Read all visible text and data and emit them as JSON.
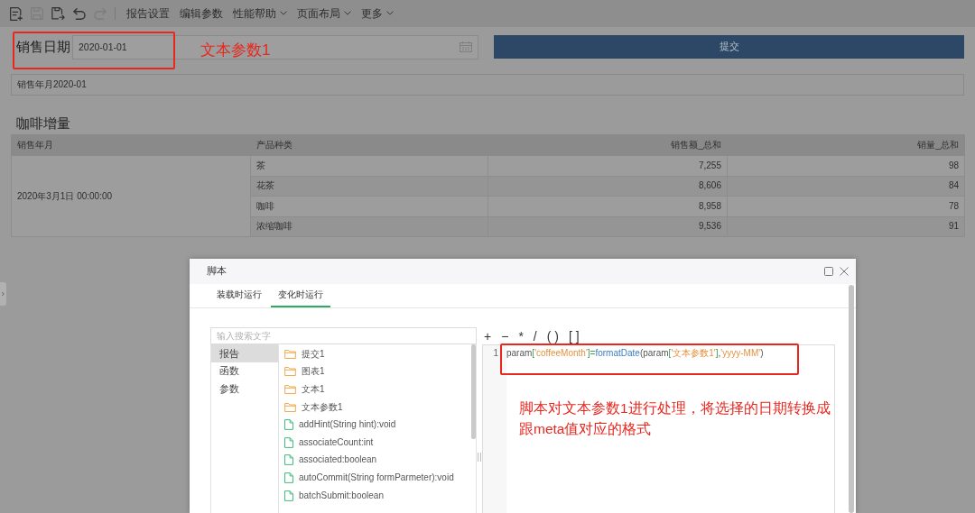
{
  "toolbar": {
    "icons": [
      {
        "kind": "new",
        "disabled": false
      },
      {
        "kind": "save",
        "disabled": true
      },
      {
        "kind": "save_as",
        "disabled": false
      },
      {
        "kind": "undo",
        "disabled": false
      },
      {
        "kind": "redo",
        "disabled": true
      }
    ],
    "menus": [
      {
        "label": "报告设置",
        "dropdown": false
      },
      {
        "label": "编辑参数",
        "dropdown": false
      },
      {
        "label": "性能帮助",
        "dropdown": true
      },
      {
        "label": "页面布局",
        "dropdown": true
      },
      {
        "label": "更多",
        "dropdown": true
      }
    ]
  },
  "filter": {
    "label": "销售日期",
    "value": "2020-01-01",
    "submit": "提交",
    "annotation": "文本参数1"
  },
  "display_text": "销售年月2020-01",
  "report": {
    "title": "咖啡增量",
    "columns": [
      {
        "label": "销售年月",
        "kind": "text"
      },
      {
        "label": "产品种类",
        "kind": "text"
      },
      {
        "label": "销售额_总和",
        "kind": "number"
      },
      {
        "label": "销量_总和",
        "kind": "number"
      }
    ],
    "groups": [
      {
        "label": "2020年3月1日 00:00:00",
        "rows": [
          [
            "茶",
            "7,255",
            "98"
          ],
          [
            "花茶",
            "8,606",
            "84"
          ],
          [
            "咖啡",
            "8,958",
            "78"
          ],
          [
            "浓缩咖啡",
            "9,536",
            "91"
          ]
        ]
      }
    ]
  },
  "dialog": {
    "title": "脚本",
    "tabs": [
      {
        "label": "装载时运行",
        "selected": false
      },
      {
        "label": "变化时运行",
        "selected": true
      }
    ],
    "search": {
      "placeholder": "输入搜索文字"
    },
    "operators": [
      "+",
      "−",
      "*",
      "/",
      "( )",
      "[ ]"
    ],
    "categories": [
      {
        "label": "报告",
        "selected": true
      },
      {
        "label": "函数",
        "selected": false
      },
      {
        "label": "参数",
        "selected": false
      }
    ],
    "members": [
      {
        "kind": "folder",
        "label": "提交1"
      },
      {
        "kind": "folder",
        "label": "图表1"
      },
      {
        "kind": "folder",
        "label": "文本1"
      },
      {
        "kind": "folder",
        "label": "文本参数1"
      },
      {
        "kind": "method",
        "label": "addHint(String hint):void"
      },
      {
        "kind": "method",
        "label": "associateCount:int"
      },
      {
        "kind": "method",
        "label": "associated:boolean"
      },
      {
        "kind": "method",
        "label": "autoCommit(String formParmeter):void"
      },
      {
        "kind": "method",
        "label": "batchSubmit:boolean"
      }
    ],
    "editor": {
      "lines": [
        {
          "number": "1",
          "tokens": [
            {
              "kind": "plain",
              "text": "param"
            },
            {
              "kind": "bracket",
              "text": "["
            },
            {
              "kind": "string",
              "text": "'coffeeMonth'"
            },
            {
              "kind": "bracket",
              "text": "]"
            },
            {
              "kind": "bracket",
              "text": "="
            },
            {
              "kind": "function",
              "text": "formatDate"
            },
            {
              "kind": "plain",
              "text": "(param"
            },
            {
              "kind": "bracket",
              "text": "["
            },
            {
              "kind": "string",
              "text": "'文本参数1'"
            },
            {
              "kind": "bracket",
              "text": "]"
            },
            {
              "kind": "plain",
              "text": ","
            },
            {
              "kind": "string",
              "text": "'yyyy-MM'"
            },
            {
              "kind": "plain",
              "text": ")"
            }
          ]
        }
      ],
      "annotation": "脚本对文本参数1进行处理，将选择的日期转换成跟meta值对应的格式"
    }
  }
}
